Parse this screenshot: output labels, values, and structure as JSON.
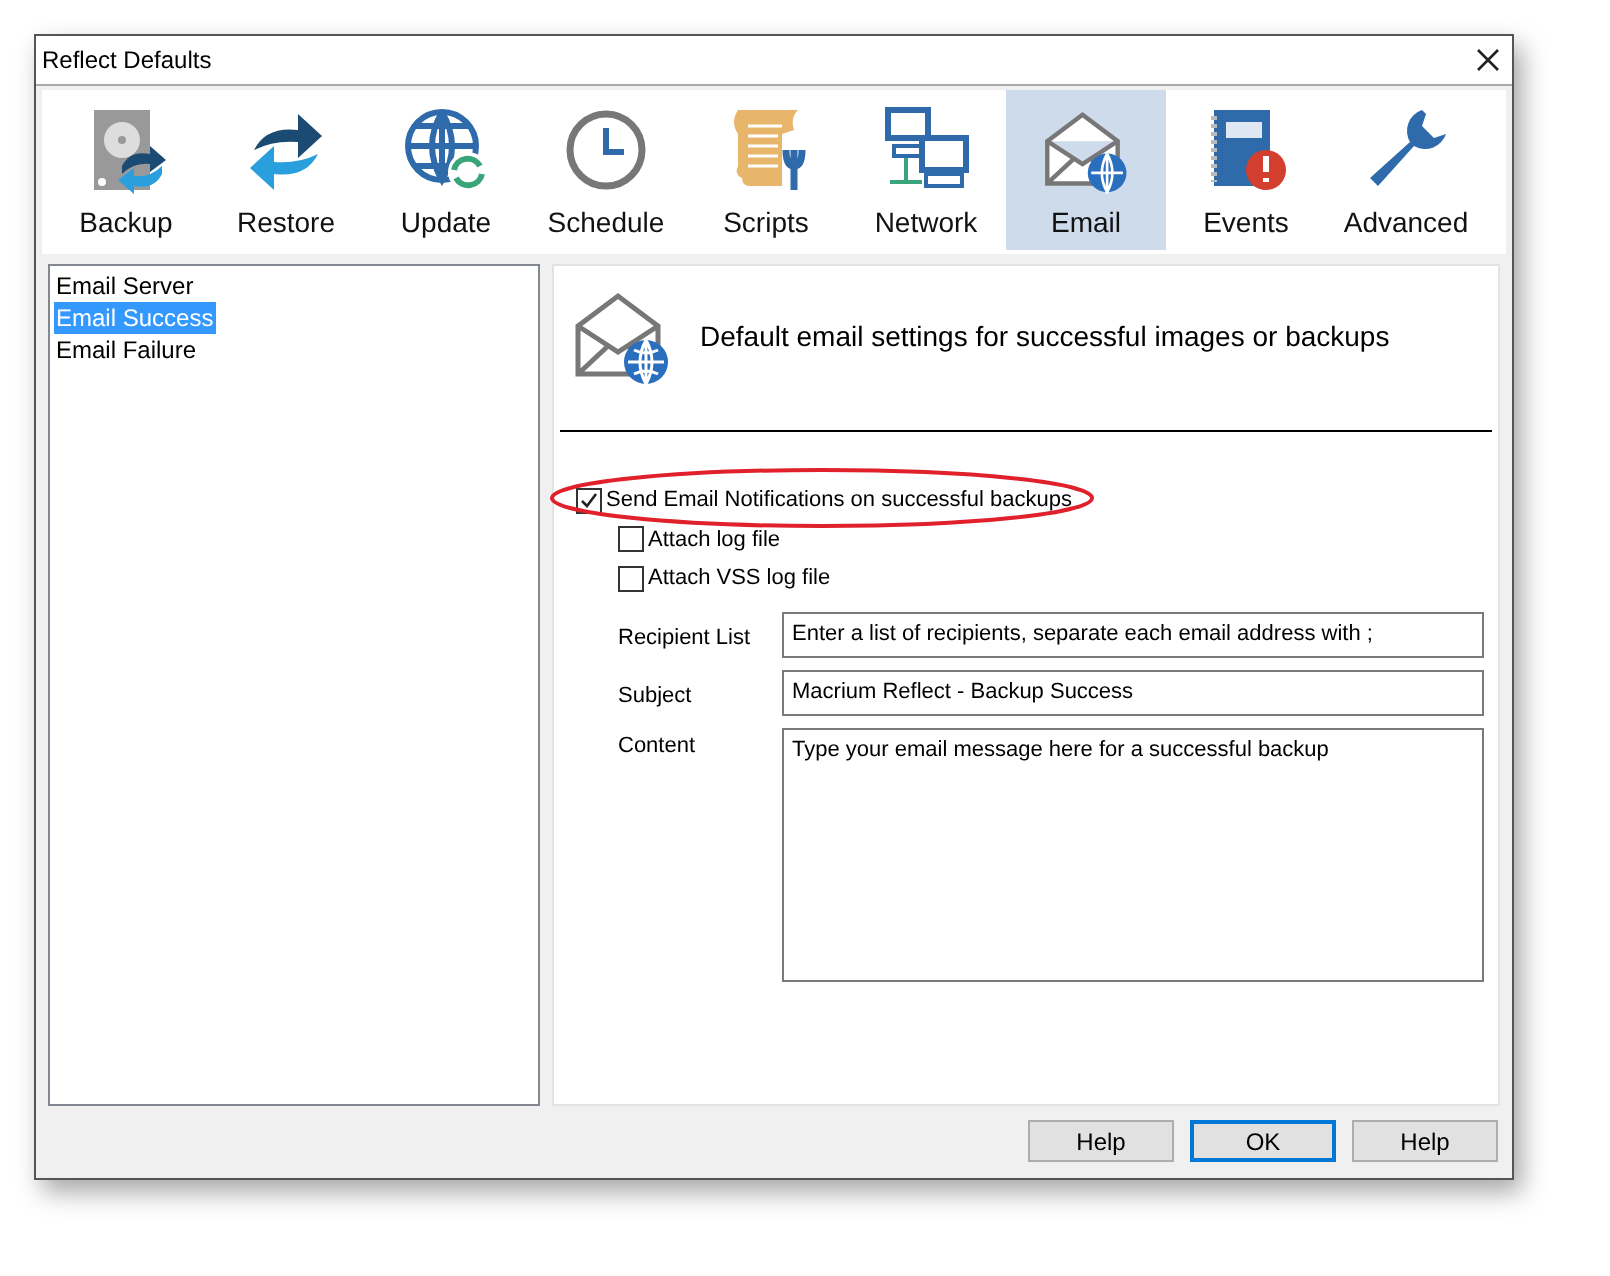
{
  "window": {
    "title": "Reflect Defaults"
  },
  "toolbar": [
    {
      "label": "Backup",
      "selected": false
    },
    {
      "label": "Restore",
      "selected": false
    },
    {
      "label": "Update",
      "selected": false
    },
    {
      "label": "Schedule",
      "selected": false
    },
    {
      "label": "Scripts",
      "selected": false
    },
    {
      "label": "Network",
      "selected": false
    },
    {
      "label": "Email",
      "selected": true
    },
    {
      "label": "Events",
      "selected": false
    },
    {
      "label": "Advanced",
      "selected": false
    }
  ],
  "sidebar": {
    "items": [
      {
        "label": "Email Server",
        "selected": false
      },
      {
        "label": "Email Success",
        "selected": true
      },
      {
        "label": "Email Failure",
        "selected": false
      }
    ]
  },
  "panel": {
    "heading": "Default email settings for successful images or backups",
    "checkboxes": [
      {
        "label": "Send Email Notifications on successful backups",
        "checked": true,
        "highlighted": true
      },
      {
        "label": "Attach log file",
        "checked": false,
        "highlighted": false
      },
      {
        "label": "Attach VSS log file",
        "checked": false,
        "highlighted": false
      }
    ],
    "fields": [
      {
        "label": "Recipient List",
        "value": "Enter a list of recipients, separate each email address with ;",
        "kind": "line"
      },
      {
        "label": "Subject",
        "value": "Macrium Reflect - Backup Success",
        "kind": "line"
      },
      {
        "label": "Content",
        "value": "Type your email message here for a successful backup",
        "kind": "area"
      }
    ]
  },
  "buttons": [
    {
      "label": "Help",
      "default": false
    },
    {
      "label": "OK",
      "default": true
    },
    {
      "label": "Help",
      "default": false
    }
  ]
}
